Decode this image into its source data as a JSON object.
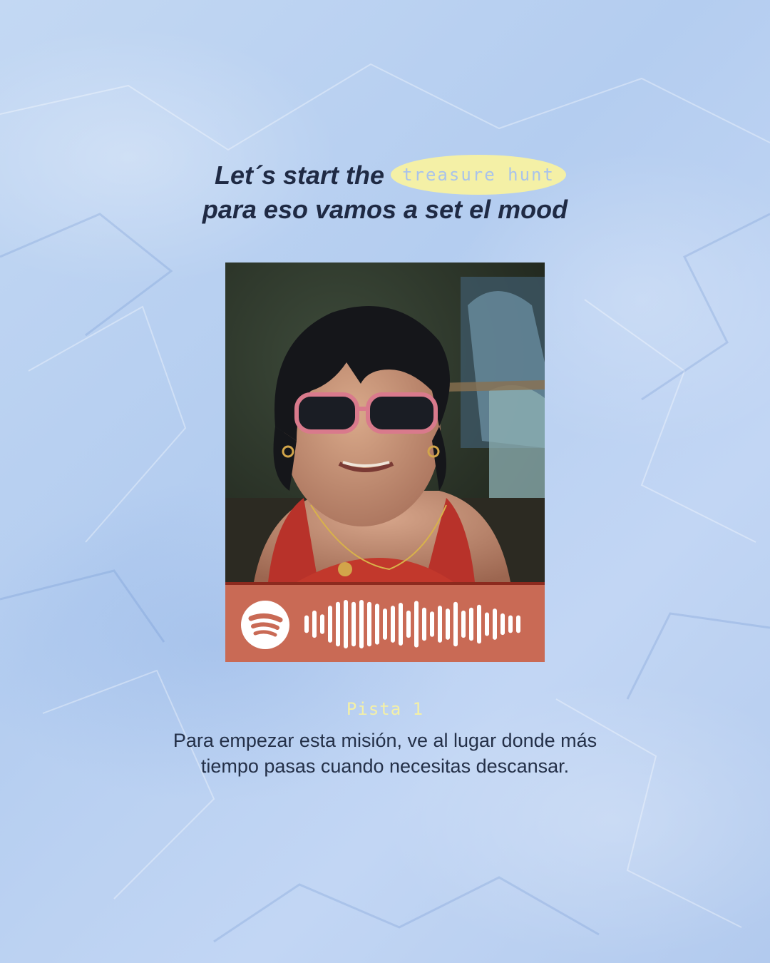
{
  "headline": {
    "line1": "Let´s start the",
    "highlight": "treasure hunt",
    "line2": "para eso vamos a set el mood"
  },
  "photo": {
    "description_icon": "photo-of-girl-with-sunglasses"
  },
  "spotify_code": {
    "icon": "spotify-icon",
    "bar_levels": [
      0.2,
      0.45,
      0.25,
      0.7,
      0.9,
      1.0,
      0.9,
      1.0,
      0.9,
      0.8,
      0.55,
      0.7,
      0.85,
      0.45,
      0.95,
      0.6,
      0.4,
      0.7,
      0.55,
      0.9,
      0.45,
      0.6,
      0.75,
      0.35,
      0.55,
      0.3,
      0.2,
      0.2
    ]
  },
  "colors": {
    "background": "#b9d0f2",
    "headline": "#1f2a44",
    "highlight": "#f4f0a6",
    "code_bar": "#c96a55",
    "code_border": "#8c2a1e",
    "clue_title": "#f4f0a6",
    "clue_text": "#243048"
  },
  "clue": {
    "title": "Pista 1",
    "text": "Para empezar esta misión, ve al lugar donde más tiempo pasas cuando necesitas descansar."
  }
}
